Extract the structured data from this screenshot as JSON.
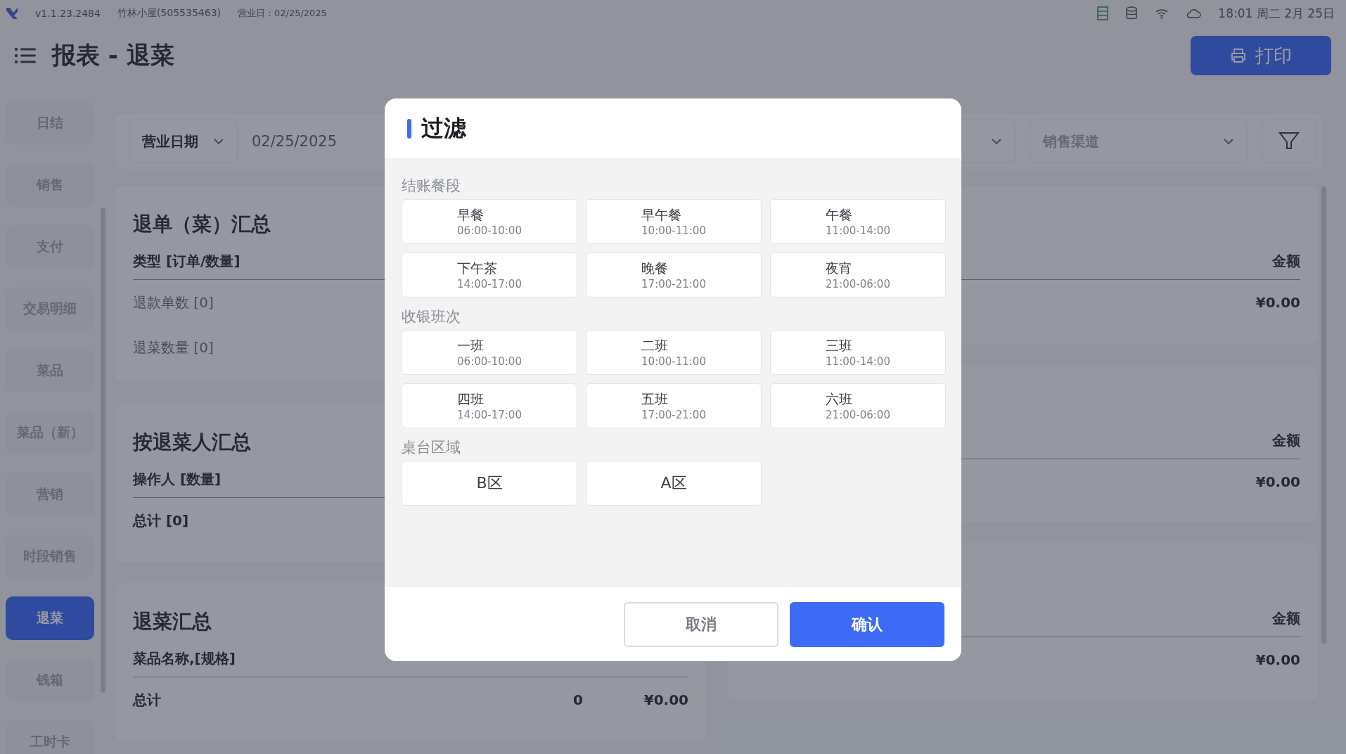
{
  "status_bar": {
    "version": "v1.1.23.2484",
    "store": "竹林小屋(505535463)",
    "business_day": "营业日：02/25/2025",
    "clock": "18:01 周二 2月 25日"
  },
  "header": {
    "title": "报表 - 退菜",
    "print_button": "打印"
  },
  "sidebar": {
    "items": [
      {
        "label": "日结",
        "selected": false
      },
      {
        "label": "销售",
        "selected": false
      },
      {
        "label": "支付",
        "selected": false
      },
      {
        "label": "交易明细",
        "selected": false
      },
      {
        "label": "菜品",
        "selected": false
      },
      {
        "label": "菜品（新）",
        "selected": false
      },
      {
        "label": "营销",
        "selected": false
      },
      {
        "label": "时段销售",
        "selected": false
      },
      {
        "label": "退菜",
        "selected": true
      },
      {
        "label": "钱箱",
        "selected": false
      },
      {
        "label": "工时卡",
        "selected": false
      }
    ]
  },
  "filter_bar": {
    "date_type": "营业日期",
    "date": "02/25/2025",
    "channel": "销售渠道"
  },
  "left_cards": [
    {
      "title": "退单（菜）汇总",
      "header": [
        "类型 [订单/数量]"
      ],
      "rows": [
        {
          "bold": false,
          "cells": [
            "退款单数 [0]"
          ]
        },
        {
          "bold": false,
          "cells": [
            "退菜数量 [0]"
          ]
        }
      ]
    },
    {
      "title": "按退菜人汇总",
      "header": [
        "操作人 [数量]"
      ],
      "rows": [
        {
          "bold": true,
          "cells": [
            "总计 [0]"
          ]
        }
      ]
    },
    {
      "title": "退菜汇总",
      "header": [
        "菜品名称,[规格]"
      ],
      "rows": [
        {
          "bold": true,
          "cells": [
            "总计",
            "0",
            "¥0.00"
          ]
        }
      ]
    }
  ],
  "right_cards": [
    {
      "header": [
        "金额"
      ],
      "rows": [
        {
          "bold": true,
          "cells": [
            "¥0.00"
          ]
        }
      ]
    },
    {
      "header": [
        "金额"
      ],
      "rows": [
        {
          "bold": true,
          "cells": [
            "¥0.00"
          ]
        }
      ]
    },
    {
      "header": [
        "金额"
      ],
      "rows": [
        {
          "bold": true,
          "cells": [
            "¥0.00"
          ]
        }
      ]
    }
  ],
  "dialog": {
    "title": "过滤",
    "sections": [
      {
        "title": "结账餐段",
        "options": [
          {
            "name": "早餐",
            "time": "06:00-10:00",
            "selected": false
          },
          {
            "name": "早午餐",
            "time": "10:00-11:00",
            "selected": false
          },
          {
            "name": "午餐",
            "time": "11:00-14:00",
            "selected": false
          },
          {
            "name": "下午茶",
            "time": "14:00-17:00",
            "selected": false
          },
          {
            "name": "晚餐",
            "time": "17:00-21:00",
            "selected": false
          },
          {
            "name": "夜宵",
            "time": "21:00-06:00",
            "selected": false
          }
        ]
      },
      {
        "title": "收银班次",
        "options": [
          {
            "name": "一班",
            "time": "06:00-10:00",
            "selected": false
          },
          {
            "name": "二班",
            "time": "10:00-11:00",
            "selected": false
          },
          {
            "name": "三班",
            "time": "11:00-14:00",
            "selected": false
          },
          {
            "name": "四班",
            "time": "14:00-17:00",
            "selected": false
          },
          {
            "name": "五班",
            "time": "17:00-21:00",
            "selected": false
          },
          {
            "name": "六班",
            "time": "21:00-06:00",
            "selected": false
          }
        ]
      },
      {
        "title": "桌台区域",
        "options": [
          {
            "name": "B区",
            "selected": false
          },
          {
            "name": "A区",
            "selected": false
          }
        ]
      }
    ],
    "cancel": "取消",
    "confirm": "确认"
  }
}
